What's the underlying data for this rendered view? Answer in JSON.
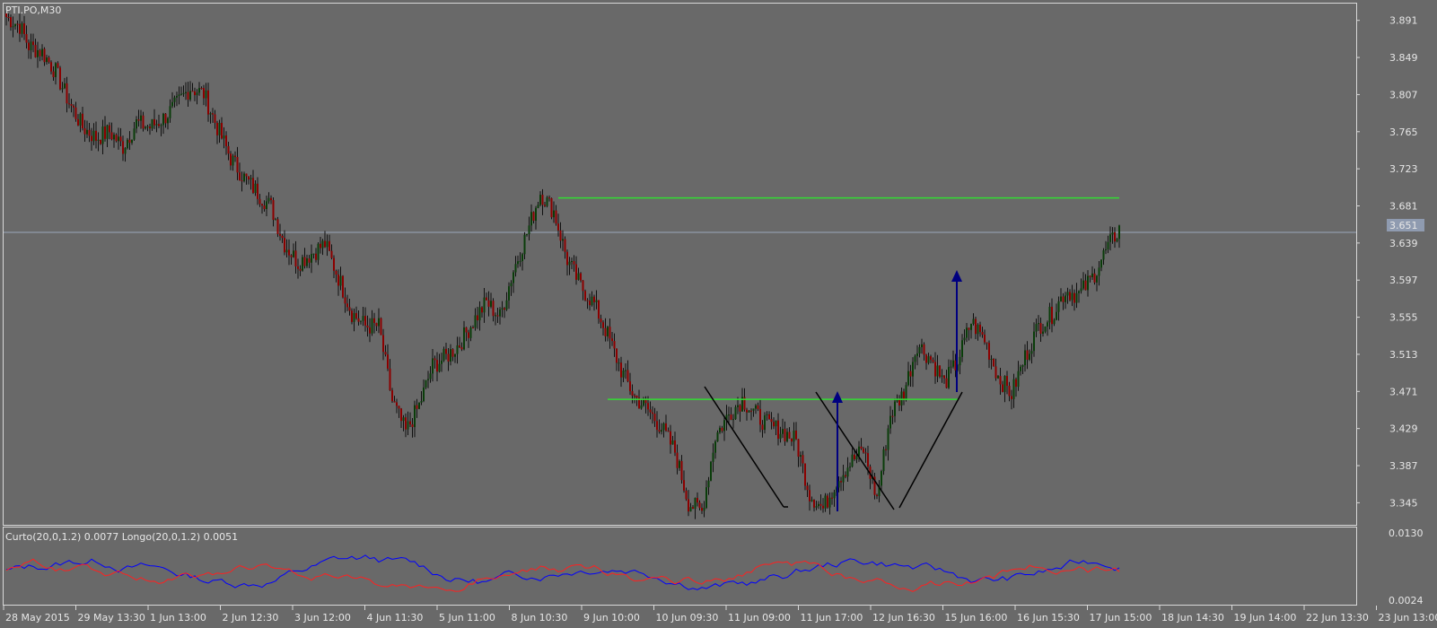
{
  "symbol_label": "PTI.PO,M30",
  "indicator": {
    "label": "Curto(20,0,1.2) 0.0077 Longo(20,0,1.2) 0.0051",
    "levels": [
      "0.0130",
      "0.0024"
    ],
    "series_colors": {
      "curto": "#0000ff",
      "longo": "#ff2020"
    }
  },
  "price_axis": {
    "ticks": [
      "3.891",
      "3.849",
      "3.807",
      "3.765",
      "3.723",
      "3.681",
      "3.639",
      "3.597",
      "3.555",
      "3.513",
      "3.471",
      "3.429",
      "3.387",
      "3.345"
    ],
    "current_price": "3.651",
    "range": [
      3.32,
      3.91
    ]
  },
  "time_axis": {
    "ticks": [
      "28 May 2015",
      "29 May 13:30",
      "1 Jun 13:00",
      "2 Jun 12:30",
      "3 Jun 12:00",
      "4 Jun 11:30",
      "5 Jun 11:00",
      "8 Jun 10:30",
      "9 Jun 10:00",
      "10 Jun 09:30",
      "11 Jun 09:00",
      "11 Jun 17:00",
      "12 Jun 16:30",
      "15 Jun 16:00",
      "16 Jun 15:30",
      "17 Jun 15:00",
      "18 Jun 14:30",
      "19 Jun 14:00",
      "22 Jun 13:30",
      "23 Jun 13:00"
    ]
  },
  "colors": {
    "background": "#696969",
    "bull_candle": "#0a3d0a",
    "bear_candle": "#8b0000",
    "wick": "#101010",
    "resistance_line": "#33dd33",
    "arrow": "#000080",
    "pattern_line": "#000000",
    "bid_line": "#9aa8bb"
  },
  "chart_data": {
    "type": "candlestick",
    "title": "PTI.PO,M30",
    "ylim": [
      3.32,
      3.91
    ],
    "anchors": [
      [
        0,
        3.895
      ],
      [
        6,
        3.885
      ],
      [
        10,
        3.862
      ],
      [
        16,
        3.855
      ],
      [
        22,
        3.833
      ],
      [
        28,
        3.798
      ],
      [
        34,
        3.77
      ],
      [
        40,
        3.758
      ],
      [
        46,
        3.765
      ],
      [
        52,
        3.748
      ],
      [
        58,
        3.775
      ],
      [
        64,
        3.77
      ],
      [
        70,
        3.78
      ],
      [
        76,
        3.796
      ],
      [
        82,
        3.815
      ],
      [
        88,
        3.808
      ],
      [
        94,
        3.77
      ],
      [
        100,
        3.735
      ],
      [
        106,
        3.713
      ],
      [
        112,
        3.696
      ],
      [
        118,
        3.68
      ],
      [
        124,
        3.638
      ],
      [
        130,
        3.617
      ],
      [
        136,
        3.627
      ],
      [
        142,
        3.638
      ],
      [
        148,
        3.6
      ],
      [
        154,
        3.56
      ],
      [
        160,
        3.545
      ],
      [
        166,
        3.545
      ],
      [
        172,
        3.46
      ],
      [
        178,
        3.425
      ],
      [
        184,
        3.455
      ],
      [
        190,
        3.5
      ],
      [
        196,
        3.51
      ],
      [
        202,
        3.525
      ],
      [
        208,
        3.55
      ],
      [
        214,
        3.572
      ],
      [
        220,
        3.555
      ],
      [
        226,
        3.608
      ],
      [
        232,
        3.65
      ],
      [
        238,
        3.696
      ],
      [
        244,
        3.675
      ],
      [
        250,
        3.62
      ],
      [
        256,
        3.59
      ],
      [
        262,
        3.57
      ],
      [
        268,
        3.535
      ],
      [
        274,
        3.495
      ],
      [
        280,
        3.465
      ],
      [
        286,
        3.45
      ],
      [
        292,
        3.43
      ],
      [
        298,
        3.403
      ],
      [
        304,
        3.345
      ],
      [
        310,
        3.335
      ],
      [
        316,
        3.42
      ],
      [
        322,
        3.445
      ],
      [
        328,
        3.462
      ],
      [
        334,
        3.445
      ],
      [
        340,
        3.432
      ],
      [
        346,
        3.426
      ],
      [
        352,
        3.415
      ],
      [
        358,
        3.355
      ],
      [
        364,
        3.338
      ],
      [
        370,
        3.37
      ],
      [
        376,
        3.39
      ],
      [
        382,
        3.405
      ],
      [
        388,
        3.35
      ],
      [
        394,
        3.445
      ],
      [
        400,
        3.47
      ],
      [
        406,
        3.525
      ],
      [
        412,
        3.508
      ],
      [
        418,
        3.48
      ],
      [
        424,
        3.505
      ],
      [
        430,
        3.55
      ],
      [
        436,
        3.53
      ],
      [
        442,
        3.488
      ],
      [
        448,
        3.468
      ],
      [
        454,
        3.51
      ],
      [
        460,
        3.545
      ],
      [
        466,
        3.558
      ],
      [
        472,
        3.585
      ],
      [
        478,
        3.58
      ],
      [
        484,
        3.6
      ],
      [
        490,
        3.63
      ],
      [
        496,
        3.655
      ]
    ],
    "resistance_levels": [
      {
        "from_bar": 246,
        "to_bar": 496,
        "price": 3.69
      },
      {
        "from_bar": 268,
        "to_bar": 424,
        "price": 3.462
      }
    ]
  }
}
